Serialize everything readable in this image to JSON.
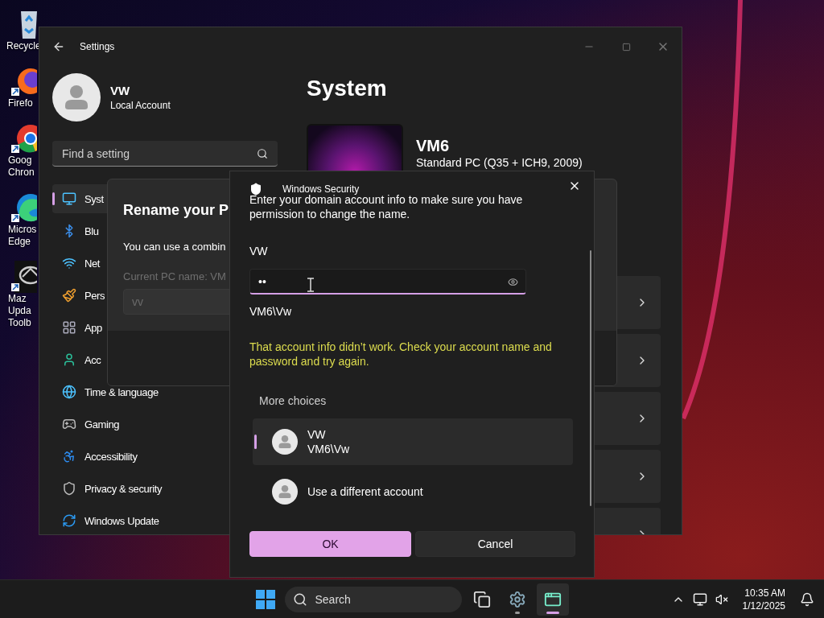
{
  "desktop_icons": [
    {
      "lines": [
        "Recycle"
      ]
    },
    {
      "lines": [
        "Firefo"
      ]
    },
    {
      "lines": [
        "Goog",
        "Chron"
      ]
    },
    {
      "lines": [
        "Micros",
        "Edge"
      ]
    },
    {
      "lines": [
        "Maz",
        "Upda",
        "Toolb"
      ]
    }
  ],
  "settings": {
    "title": "Settings",
    "account": {
      "name": "VW",
      "type": "Local Account"
    },
    "search": {
      "placeholder": "Find a setting"
    },
    "nav": [
      {
        "label": "Syst",
        "selected": true
      },
      {
        "label": "Blu",
        "selected": false
      },
      {
        "label": "Net",
        "selected": false
      },
      {
        "label": "Pers",
        "selected": false
      },
      {
        "label": "App",
        "selected": false
      },
      {
        "label": "Acc",
        "selected": false
      },
      {
        "label": "Time & language",
        "selected": false
      },
      {
        "label": "Gaming",
        "selected": false
      },
      {
        "label": "Accessibility",
        "selected": false
      },
      {
        "label": "Privacy & security",
        "selected": false
      },
      {
        "label": "Windows Update",
        "selected": false
      }
    ],
    "page_title": "System",
    "device": {
      "name": "VM6",
      "model": "Standard PC (Q35 + ICH9, 2009)"
    }
  },
  "rename_dialog": {
    "title": "Rename your P",
    "description": "You can use a combin",
    "current_name": "Current PC name: VM",
    "field_value": "vv"
  },
  "security_dialog": {
    "app_title": "Windows Security",
    "message": "Enter your domain account info to make sure you have permission to change the name.",
    "username": "VW",
    "password_mask": "••",
    "domain": "VM6\\Vw",
    "error": "That account info didn’t work. Check your account name and password and try again.",
    "more_choices": "More choices",
    "accounts": [
      {
        "name": "VW",
        "domain": "VM6\\Vw",
        "selected": true
      },
      {
        "name": "Use a different account",
        "selected": false
      }
    ],
    "buttons": [
      {
        "label": "OK",
        "kind": "primary"
      },
      {
        "label": "Cancel",
        "kind": "secondary"
      }
    ]
  },
  "taskbar": {
    "search": {
      "placeholder": "Search"
    },
    "apps": [
      {
        "running": false,
        "active": false
      },
      {
        "running": true,
        "active": false
      },
      {
        "running": true,
        "active": true
      }
    ],
    "time": "10:35 AM",
    "date": "1/12/2025"
  }
}
